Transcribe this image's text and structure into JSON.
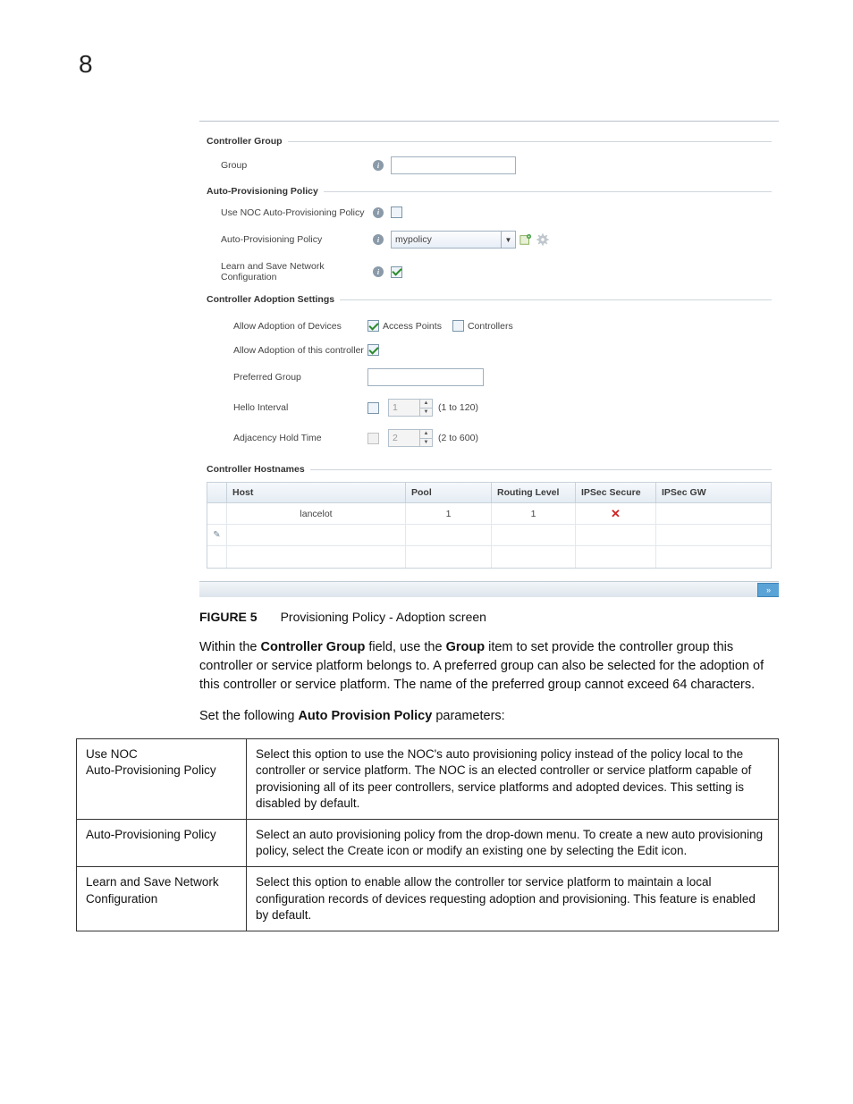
{
  "page_number": "8",
  "figure": {
    "sections": {
      "controller_group": {
        "title": "Controller Group",
        "group_label": "Group",
        "group_value": ""
      },
      "auto_prov": {
        "title": "Auto-Provisioning Policy",
        "use_noc_label": "Use NOC Auto-Provisioning Policy",
        "use_noc_checked": false,
        "policy_label": "Auto-Provisioning Policy",
        "policy_value": "mypolicy",
        "learn_save_label": "Learn and Save Network Configuration",
        "learn_save_checked": true
      },
      "adoption": {
        "title": "Controller Adoption Settings",
        "allow_devices_label": "Allow Adoption of Devices",
        "allow_devices_ap_label": "Access Points",
        "allow_devices_ap_checked": true,
        "allow_devices_ctrl_label": "Controllers",
        "allow_devices_ctrl_checked": false,
        "allow_this_label": "Allow Adoption of this controller",
        "allow_this_checked": true,
        "preferred_group_label": "Preferred Group",
        "preferred_group_value": "",
        "hello_label": "Hello Interval",
        "hello_checked": false,
        "hello_value": "1",
        "hello_range": "(1 to 120)",
        "adj_label": "Adjacency Hold Time",
        "adj_checked": false,
        "adj_value": "2",
        "adj_range": "(2 to 600)"
      },
      "hostnames": {
        "title": "Controller Hostnames",
        "headers": {
          "host": "Host",
          "pool": "Pool",
          "routing_level": "Routing Level",
          "ipsec_secure": "IPSec Secure",
          "ipsec_gw": "IPSec GW"
        },
        "rows": [
          {
            "host": "lancelot",
            "pool": "1",
            "routing_level": "1",
            "ipsec_secure": "x",
            "ipsec_gw": ""
          },
          {
            "host": "",
            "pool": "",
            "routing_level": "",
            "ipsec_secure": "",
            "ipsec_gw": ""
          },
          {
            "host": "",
            "pool": "",
            "routing_level": "",
            "ipsec_secure": "",
            "ipsec_gw": ""
          }
        ]
      }
    }
  },
  "caption": {
    "label": "FIGURE 5",
    "text": "Provisioning Policy - Adoption screen"
  },
  "paragraphs": {
    "p1_pre": "Within the ",
    "p1_b1": "Controller Group",
    "p1_mid1": " field, use the ",
    "p1_b2": "Group",
    "p1_mid2": " item to set provide the controller group this controller or service platform belongs to. A preferred group can also be selected for the adoption of this controller or service platform. The name of the preferred group cannot exceed 64 characters.",
    "p2_pre": "Set the following ",
    "p2_b1": "Auto Provision Policy",
    "p2_post": " parameters:"
  },
  "table": [
    {
      "name_line1": "Use NOC",
      "name_line2": "Auto-Provisioning Policy",
      "desc": "Select this option to use the NOC's auto provisioning policy instead of the policy local to the controller or service platform. The NOC is an elected controller or service platform capable of provisioning all of its peer controllers, service platforms and adopted devices. This setting is disabled by default."
    },
    {
      "name_line1": "Auto-Provisioning Policy",
      "name_line2": "",
      "desc_pre": "Select an auto provisioning policy from the drop-down menu. To create a new auto provisioning policy, select the ",
      "desc_i1": "Create",
      "desc_mid": " icon or modify an existing one by selecting the ",
      "desc_i2": "Edit",
      "desc_post": " icon."
    },
    {
      "name_line1": "Learn and Save Network",
      "name_line2": "Configuration",
      "desc": "Select this option to enable allow the controller tor service platform to maintain a local configuration records of devices requesting adoption and provisioning. This feature is enabled by default."
    }
  ]
}
